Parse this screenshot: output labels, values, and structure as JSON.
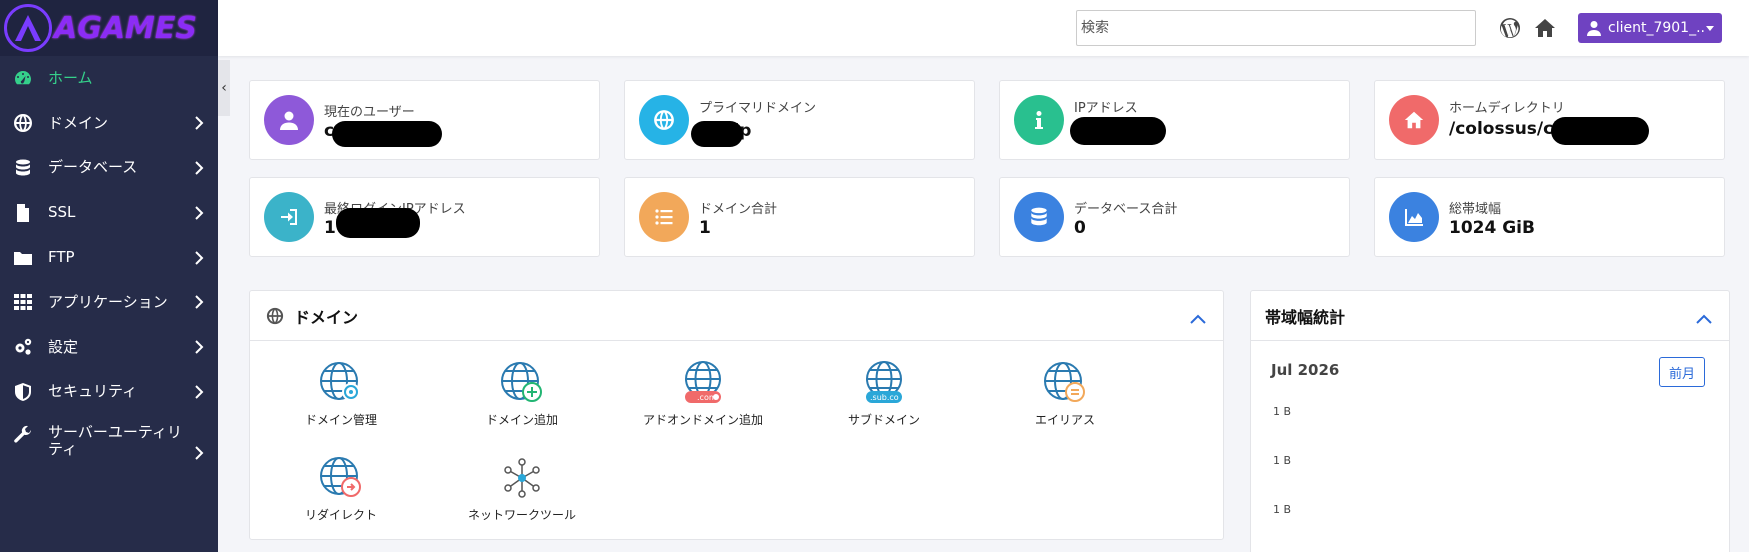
{
  "brand": {
    "name": "AGAMES"
  },
  "sidebar": {
    "items": [
      {
        "label": "ホーム",
        "icon": "dashboard-icon",
        "active": true
      },
      {
        "label": "ドメイン",
        "icon": "globe-icon"
      },
      {
        "label": "データベース",
        "icon": "database-icon"
      },
      {
        "label": "SSL",
        "icon": "file-icon"
      },
      {
        "label": "FTP",
        "icon": "folder-icon"
      },
      {
        "label": "アプリケーション",
        "icon": "grid-icon"
      },
      {
        "label": "設定",
        "icon": "gears-icon"
      },
      {
        "label": "セキュリティ",
        "icon": "shield-icon"
      },
      {
        "label": "サーバーユーティリティ",
        "icon": "wrench-icon"
      }
    ],
    "collapse_glyph": "‹"
  },
  "header": {
    "search_placeholder": "検索",
    "user_label": "client_7901_.."
  },
  "cards": [
    {
      "title": "現在のユーザー",
      "value": "c",
      "color": "#8e59d9",
      "icon": "user-icon"
    },
    {
      "title": "プライマリドメイン",
      "value": ".jp",
      "color": "#26b3e6",
      "icon": "globe-icon"
    },
    {
      "title": "IPアドレス",
      "value": "",
      "color": "#29c08f",
      "icon": "info-icon"
    },
    {
      "title": "ホームディレクトリ",
      "value": "/colossus/cl",
      "color": "#f06a6a",
      "icon": "home-icon"
    },
    {
      "title": "最終ログインIPアドレス",
      "value": "1            4",
      "color": "#3bb3c9",
      "icon": "login-icon"
    },
    {
      "title": "ドメイン合計",
      "value": "1",
      "color": "#f2a85a",
      "icon": "list-icon"
    },
    {
      "title": "データベース合計",
      "value": "0",
      "color": "#3b82e0",
      "icon": "database-icon"
    },
    {
      "title": "総帯域幅",
      "value": "1024 GiB",
      "color": "#3b82e0",
      "icon": "area-chart-icon"
    }
  ],
  "domain_panel": {
    "title": "ドメイン",
    "tiles": [
      {
        "label": "ドメイン管理",
        "badge": "gear"
      },
      {
        "label": "ドメイン追加",
        "badge": "plus"
      },
      {
        "label": "アドオンドメイン追加",
        "badge": ".com"
      },
      {
        "label": "サブドメイン",
        "badge": ".sub.co"
      },
      {
        "label": "エイリアス",
        "badge": "equals"
      },
      {
        "label": "リダイレクト",
        "badge": "arrow"
      },
      {
        "label": "ネットワークツール",
        "badge": "network"
      }
    ]
  },
  "bandwidth_panel": {
    "title": "帯域幅統計",
    "month": "Jul 2026",
    "prev_button": "前月",
    "ticks": [
      "1 B",
      "1 B",
      "1 B"
    ]
  }
}
